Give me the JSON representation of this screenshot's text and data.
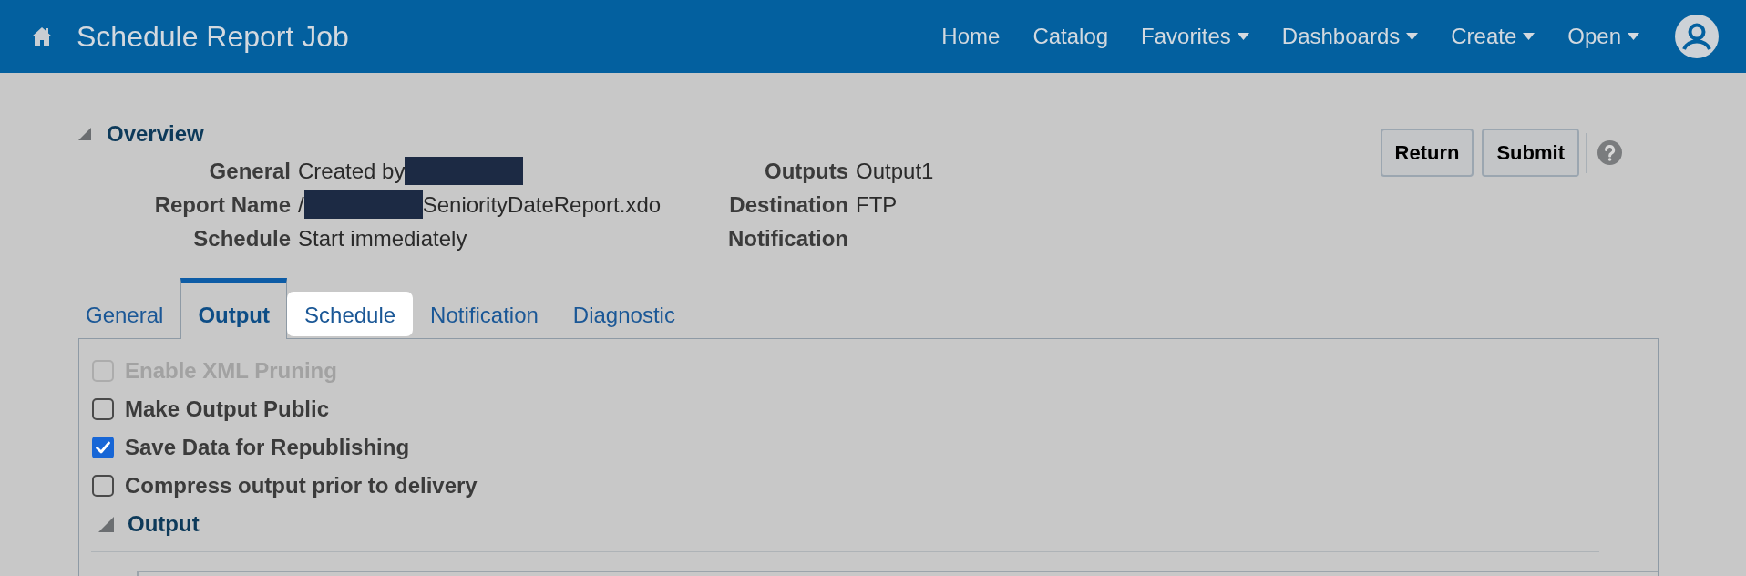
{
  "header": {
    "title": "Schedule Report Job",
    "nav": [
      {
        "label": "Home",
        "has_menu": false
      },
      {
        "label": "Catalog",
        "has_menu": false
      },
      {
        "label": "Favorites",
        "has_menu": true
      },
      {
        "label": "Dashboards",
        "has_menu": true
      },
      {
        "label": "Create",
        "has_menu": true
      },
      {
        "label": "Open",
        "has_menu": true
      }
    ]
  },
  "overview": {
    "title": "Overview",
    "expanded": true,
    "columns": [
      [
        {
          "label": "General",
          "value": [
            {
              "kind": "text",
              "text": "Created by"
            },
            {
              "kind": "redacted"
            }
          ]
        },
        {
          "label": "Report Name",
          "value": [
            {
              "kind": "text",
              "text": "/"
            },
            {
              "kind": "redacted"
            },
            {
              "kind": "text",
              "text": "SeniorityDateReport.xdo"
            }
          ]
        },
        {
          "label": "Schedule",
          "value": [
            {
              "kind": "text",
              "text": "Start immediately"
            }
          ]
        }
      ],
      [
        {
          "label": "Outputs",
          "value": [
            {
              "kind": "text",
              "text": "Output1"
            }
          ]
        },
        {
          "label": "Destination",
          "value": [
            {
              "kind": "text",
              "text": "FTP"
            }
          ]
        },
        {
          "label": "Notification"
        }
      ]
    ]
  },
  "actions": [
    {
      "label": "Return"
    },
    {
      "label": "Submit"
    }
  ],
  "tabs": [
    {
      "label": "General",
      "selected": false,
      "hovered": false
    },
    {
      "label": "Output",
      "selected": true,
      "hovered": false
    },
    {
      "label": "Schedule",
      "selected": false,
      "hovered": true
    },
    {
      "label": "Notification",
      "selected": false,
      "hovered": false
    },
    {
      "label": "Diagnostic",
      "selected": false,
      "hovered": false
    }
  ],
  "options": [
    {
      "label": "Enable XML Pruning",
      "checked": false,
      "disabled": true
    },
    {
      "label": "Make Output Public",
      "checked": false,
      "disabled": false
    },
    {
      "label": "Save Data for Republishing",
      "checked": true,
      "disabled": false
    },
    {
      "label": "Compress output prior to delivery",
      "checked": false,
      "disabled": false
    }
  ],
  "output_section": {
    "title": "Output",
    "expanded": true
  }
}
